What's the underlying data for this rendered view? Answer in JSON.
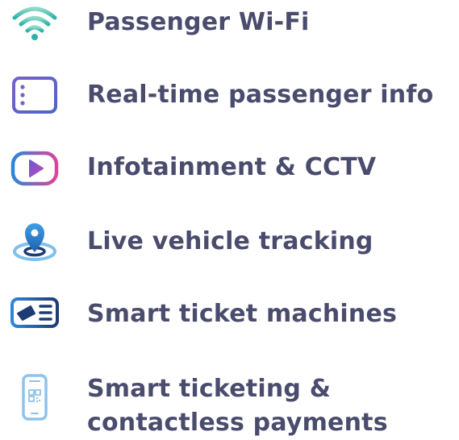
{
  "features": [
    {
      "label": "Passenger Wi-Fi",
      "icon": "wifi-icon"
    },
    {
      "label": "Real-time passenger info",
      "icon": "list-icon"
    },
    {
      "label": "Infotainment & CCTV",
      "icon": "play-icon"
    },
    {
      "label": "Live vehicle tracking",
      "icon": "location-pin-icon"
    },
    {
      "label": "Smart ticket machines",
      "icon": "ticket-machine-icon"
    },
    {
      "label_line1": "Smart ticketing &",
      "label_line2": "contactless payments",
      "icon": "phone-qr-icon"
    }
  ],
  "colors": {
    "text": "#4a4c6e",
    "teal": "#2bb3a8",
    "purple": "#7b5fc7",
    "blue": "#2d86d6",
    "pink": "#e0439a",
    "navy": "#1f3b73",
    "light_blue": "#8ec4ec"
  }
}
